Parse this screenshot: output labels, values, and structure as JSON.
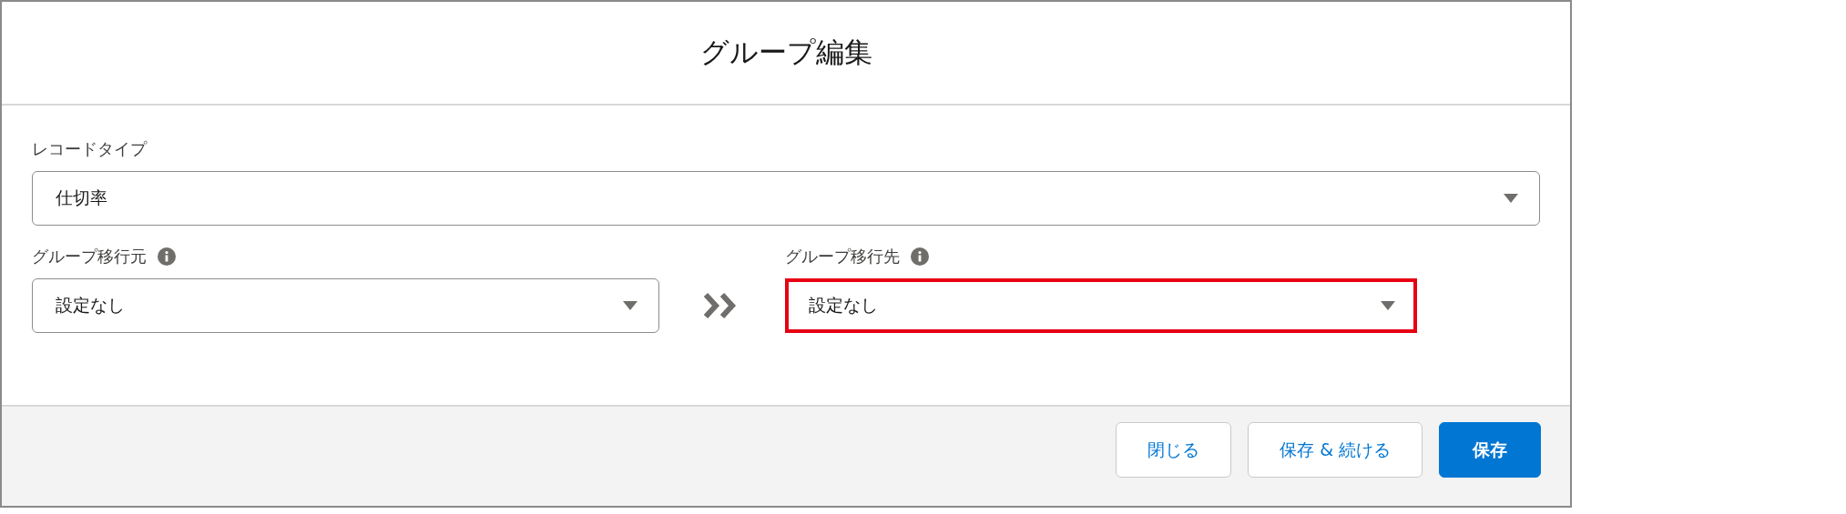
{
  "dialog": {
    "title": "グループ編集"
  },
  "record_type": {
    "label": "レコードタイプ",
    "value": "仕切率"
  },
  "fields": [
    {
      "label": "グループ移行元",
      "value": "設定なし",
      "info": true,
      "highlighted": false
    },
    {
      "label": "グループ移行先",
      "value": "設定なし",
      "info": true,
      "highlighted": true
    }
  ],
  "buttons": [
    {
      "label": "閉じる",
      "kind": "neutral"
    },
    {
      "label": "保存 & 続ける",
      "kind": "neutral"
    },
    {
      "label": "保存",
      "kind": "brand"
    }
  ]
}
